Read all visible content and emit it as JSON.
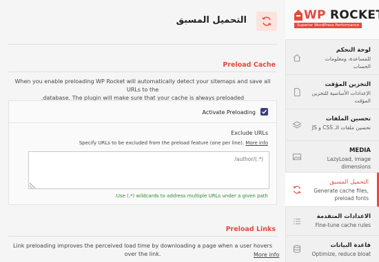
{
  "brand": {
    "logo_wp": "WP",
    "logo_rocket": "ROCKET",
    "logo_subtitle": "Superior WordPress Performance"
  },
  "sidebar": {
    "items": [
      {
        "title": "لوحة التحكم",
        "desc": "للمساعدة، ومعلومات الحساب",
        "icon": "home-icon"
      },
      {
        "title": "التخزين المؤقت",
        "desc": "الإعدادات الأساسية للتخزين المؤقت",
        "icon": "file-icon"
      },
      {
        "title": "تحسين الملفات",
        "desc": "تحسين ملفات الـ CSS و JS",
        "icon": "layers-icon"
      },
      {
        "title": "MEDIA",
        "desc": "LazyLoad, image dimensions",
        "icon": "media-icon"
      },
      {
        "title": "التحميل المسبق",
        "desc": "Generate cache files, preload fonts",
        "icon": "refresh-icon"
      },
      {
        "title": "الاعدادات المتقدمة",
        "desc": "Fine-tune cache rules",
        "icon": "list-icon"
      },
      {
        "title": "قاعدة البيانات",
        "desc": "Optimize, reduce bloat",
        "icon": "database-icon"
      }
    ],
    "active_index": 4
  },
  "page": {
    "title": "التحميل المسبق",
    "icon": "refresh-icon"
  },
  "preload_cache": {
    "section_title": "Preload Cache",
    "description_line1": "When you enable preloading WP Rocket will automatically detect your sitemaps and save all URLs to the",
    "description_line2": ".database. The plugin will make sure that your cache is always preloaded",
    "toggle_label": "Activate Preloading",
    "toggle_checked": true,
    "exclude_title": "Exclude URLs",
    "exclude_help": "Specify URLs to be excluded from the preload feature (one per line).",
    "exclude_more_info": "More info",
    "textarea_placeholder": "/author/(.*)",
    "hint": ".Use (.*) wildcards to address multiple URLs under a given path"
  },
  "preload_links": {
    "section_title": "Preload Links",
    "description": "Link preloading improves the perceived load time by downloading a page when a user hovers over the link.",
    "more_info": "More info"
  },
  "colors": {
    "accent": "#e8473c",
    "checkbox": "#3a3f7a",
    "hint_green": "#2c8c2c"
  }
}
